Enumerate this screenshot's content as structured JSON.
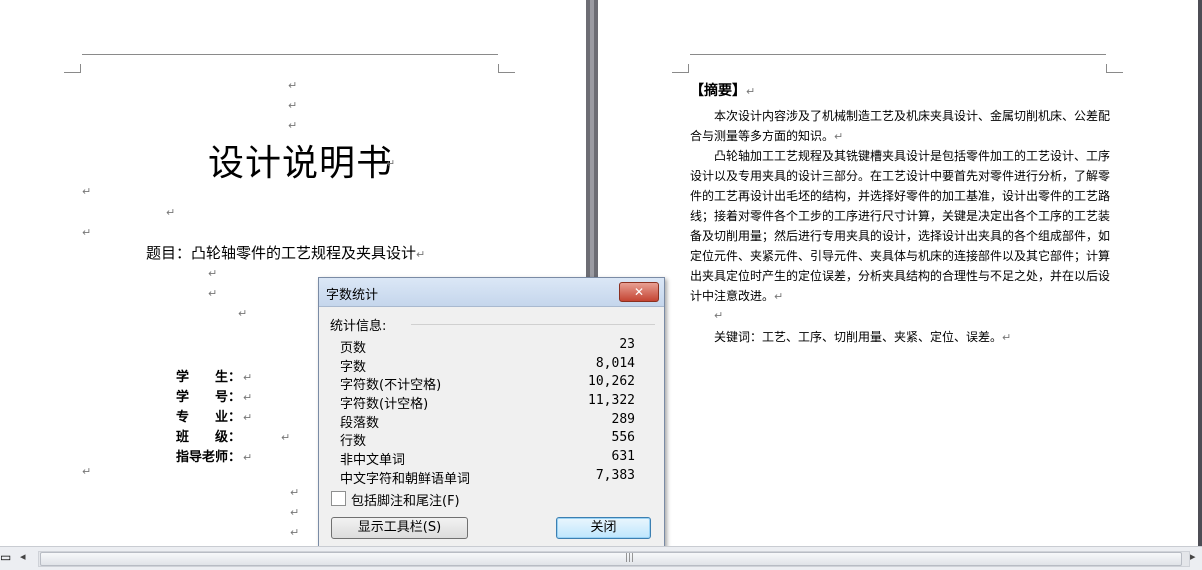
{
  "left_page": {
    "title": "设计说明书",
    "subject": "题目：凸轮轴零件的工艺规程及夹具设计",
    "fields": [
      "学　　生：",
      "学　　号：",
      "专　　业：",
      "班　　级：",
      "指导老师："
    ]
  },
  "right_page": {
    "abstract_heading": "【摘要】",
    "paragraphs": [
      "本次设计内容涉及了机械制造工艺及机床夹具设计、金属切削机床、公差配合与测量等多方面的知识。",
      "凸轮轴加工工艺规程及其铣键槽夹具设计是包括零件加工的工艺设计、工序设计以及专用夹具的设计三部分。在工艺设计中要首先对零件进行分析，了解零件的工艺再设计出毛坯的结构，并选择好零件的加工基准，设计出零件的工艺路线；接着对零件各个工步的工序进行尺寸计算，关键是决定出各个工序的工艺装备及切削用量；然后进行专用夹具的设计，选择设计出夹具的各个组成部件，如定位元件、夹紧元件、引导元件、夹具体与机床的连接部件以及其它部件；计算出夹具定位时产生的定位误差，分析夹具结构的合理性与不足之处，并在以后设计中注意改进。"
    ],
    "keywords": "关键词：工艺、工序、切削用量、夹紧、定位、误差。"
  },
  "paragraph_mark": "↵",
  "dialog": {
    "title": "字数统计",
    "close_icon": "close-icon",
    "section_label": "统计信息:",
    "stats": [
      {
        "label": "页数",
        "value": "23"
      },
      {
        "label": "字数",
        "value": "8,014"
      },
      {
        "label": "字符数(不计空格)",
        "value": "10,262"
      },
      {
        "label": "字符数(计空格)",
        "value": "11,322"
      },
      {
        "label": "段落数",
        "value": "289"
      },
      {
        "label": "行数",
        "value": "556"
      },
      {
        "label": "非中文单词",
        "value": "631"
      },
      {
        "label": "中文字符和朝鲜语单词",
        "value": "7,383"
      }
    ],
    "checkbox_label": "包括脚注和尾注(F)",
    "checkbox_checked": false,
    "toolbar_button": "显示工具栏(S)",
    "close_button": "关闭"
  },
  "statusbar": {
    "left_arrow": "◂",
    "right_arrow": "▸",
    "grip": "|||"
  }
}
